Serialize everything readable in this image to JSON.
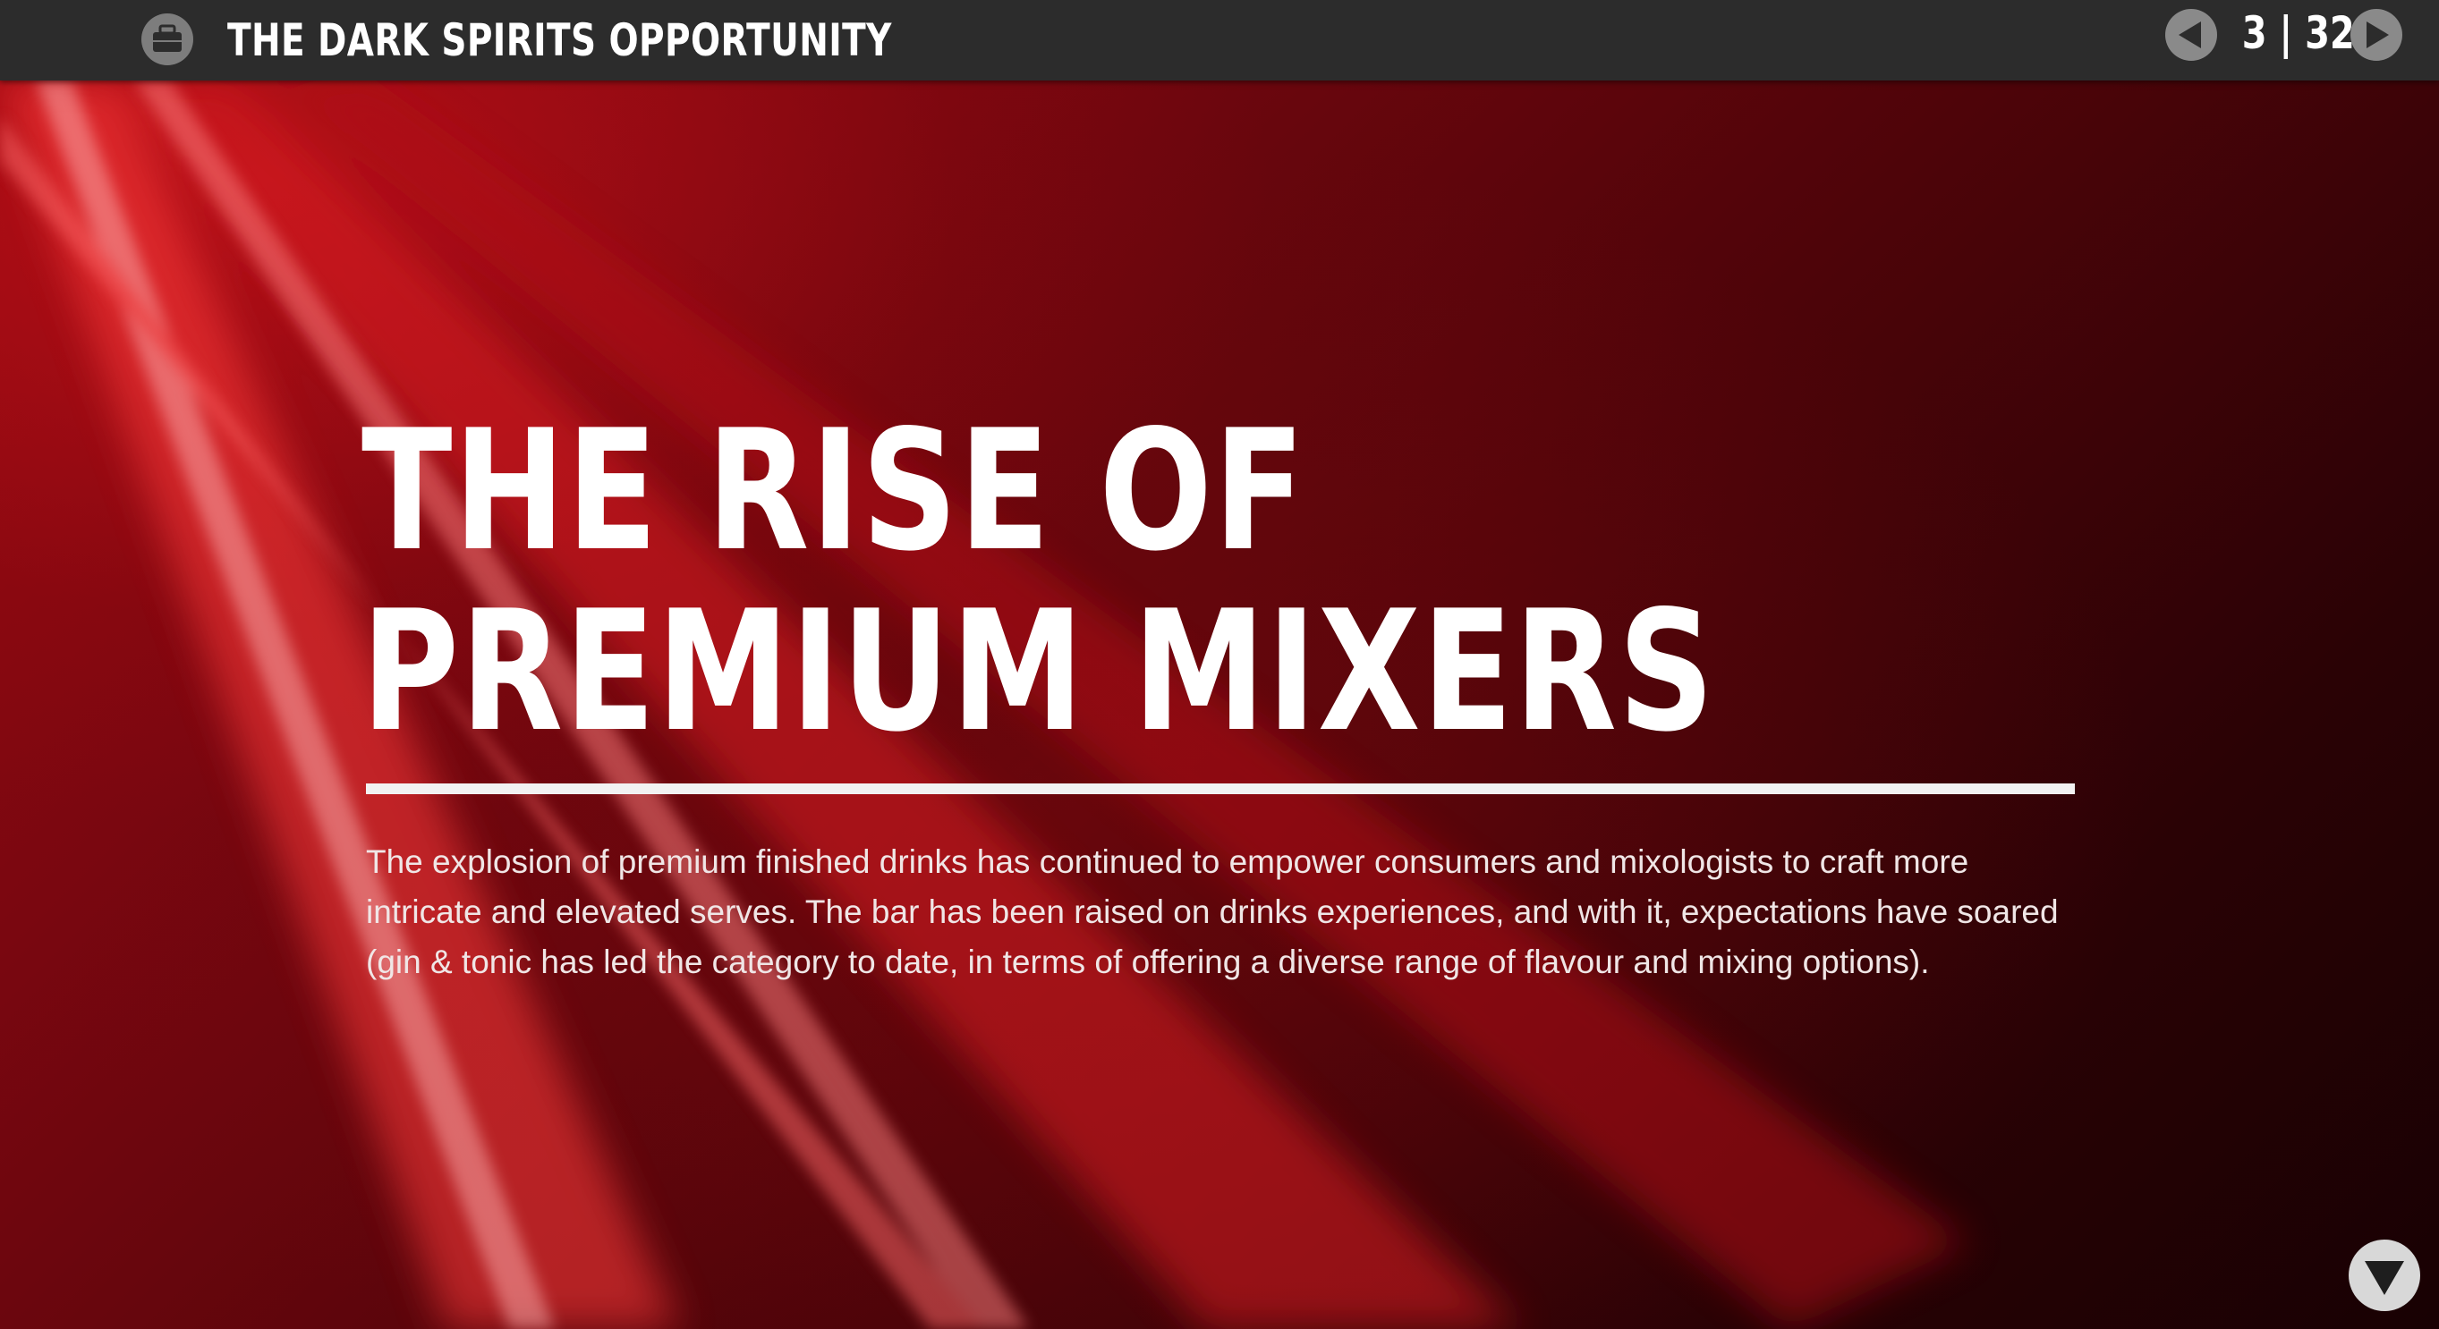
{
  "header": {
    "menu_icon": "briefcase-icon",
    "title": "THE DARK SPIRITS OPPORTUNITY",
    "prev_icon": "triangle-left-icon",
    "next_icon": "triangle-right-icon",
    "page_current": "3",
    "page_separator": "|",
    "page_total": "32"
  },
  "slide": {
    "headline_line1": "THE RISE OF",
    "headline_line2": "PREMIUM MIXERS",
    "body": "The explosion of premium finished drinks has continued to empower consumers and mixologists to craft more intricate and elevated serves. The bar has been raised on drinks experiences, and with it, expectations have soared (gin & tonic has led the category to date, in terms of offering a diverse range of flavour and mixing options)."
  },
  "footer": {
    "scroll_icon": "triangle-down-icon"
  },
  "colors": {
    "topbar": "#2c2c2c",
    "background_red": "#9c0a12",
    "background_dark": "#180103",
    "text": "#ffffff",
    "button_grey": "#8a8a8a"
  }
}
